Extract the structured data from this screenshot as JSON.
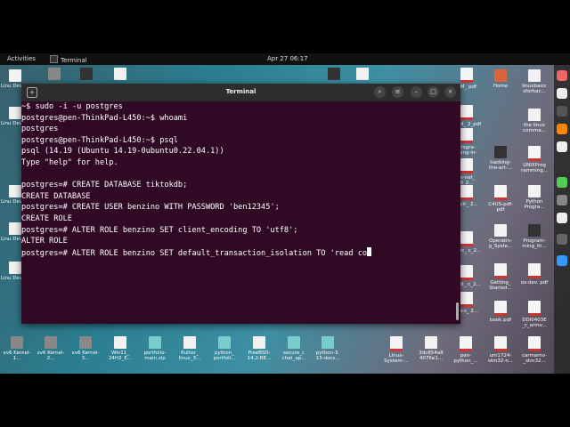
{
  "topbar": {
    "activities": "Activities",
    "app": "Terminal",
    "clock": "Apr 27  06:17"
  },
  "terminal": {
    "title": "Terminal",
    "lines": [
      "~$ sudo -i -u postgres",
      "postgres@pen-ThinkPad-L450:~$ whoami",
      "postgres",
      "postgres@pen-ThinkPad-L450:~$ psql",
      "psql (14.19 (Ubuntu 14.19-0ubuntu0.22.04.1))",
      "Type \"help\" for help.",
      "",
      "postgres=# CREATE DATABASE tiktokdb;",
      "CREATE DATABASE",
      "postgres=# CREATE USER benzino WITH PASSWORD 'ben12345';",
      "CREATE ROLE",
      "postgres=# ALTER ROLE benzino SET client_encoding TO 'utf8';",
      "ALTER ROLE",
      "postgres=# ALTER ROLE benzino SET default_transaction_isolation TO 'read co"
    ]
  },
  "desktop": {
    "left": [
      {
        "label": "Linu Device"
      },
      {
        "label": "Linu Device"
      },
      {
        "label": "Linu Device"
      },
      {
        "label": "Linu Device"
      },
      {
        "label": "Linu Device"
      }
    ],
    "right_col1": [
      {
        "label": "BM_ pdf"
      },
      {
        "label": "c_a4_ 2_pdf"
      },
      {
        "label": "Progra- ming-in-"
      },
      {
        "label": "m-net_ 8_2..."
      },
      {
        "label": "n-clr_ 2..."
      },
      {
        "label": "n-ipc_ c_2..."
      },
      {
        "label": "n-git_ c_2..."
      },
      {
        "label": "n-ics_ 2..."
      },
      {
        "label": "Linux- System-..."
      }
    ],
    "right_col2": [
      {
        "label": "Home"
      },
      {
        "label": "hacking- the-art-..."
      },
      {
        "label": "C4US-pdf- pdf"
      },
      {
        "label": "Operatin- g_Syste..."
      },
      {
        "label": "Getting_ Started..."
      },
      {
        "label": "book.pdf"
      }
    ],
    "right_col3": [
      {
        "label": "linuxbasic sforhac..."
      },
      {
        "label": "the linux comma..."
      },
      {
        "label": "UNIXProg ramming..."
      },
      {
        "label": "Python Progra..."
      },
      {
        "label": "Program- ming_th..."
      },
      {
        "label": "os-dev. pdf"
      },
      {
        "label": "DDI0403E _c_armv..."
      }
    ],
    "bottom": [
      {
        "label": "xv6 Kernel-1..."
      },
      {
        "label": "xv6 Kernel-2..."
      },
      {
        "label": "xv6 Kernel-3..."
      },
      {
        "label": "Win11_ 24H2_E..."
      },
      {
        "label": "portfolio- main.zip"
      },
      {
        "label": "flutter_ linux_3..."
      },
      {
        "label": "python_ portfoli..."
      },
      {
        "label": "FreeBSD- 14.2-RE..."
      },
      {
        "label": "secure_c chat_ap..."
      },
      {
        "label": "python-3. 13-docs..."
      },
      {
        "label": "3dc854a8 4076e1..."
      },
      {
        "label": "pen- python_..."
      },
      {
        "label": "um1724- stm32-n..."
      },
      {
        "label": "carmamo- _stm32..."
      }
    ]
  }
}
